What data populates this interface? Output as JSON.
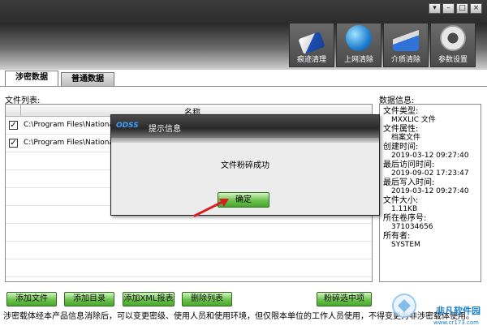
{
  "window": {
    "buttons": [
      "▾",
      "–",
      "□",
      "×"
    ]
  },
  "toolbar": [
    {
      "label": "痕迹清理",
      "icon": "eraser-icon"
    },
    {
      "label": "上网清除",
      "icon": "globe-icon"
    },
    {
      "label": "介质清除",
      "icon": "broom-icon"
    },
    {
      "label": "参数设置",
      "icon": "gear-icon"
    }
  ],
  "tabs": [
    {
      "label": "涉密数据",
      "active": true
    },
    {
      "label": "普通数据",
      "active": false
    }
  ],
  "labels": {
    "file_list": "文件列表:",
    "data_info": "数据信息:"
  },
  "table": {
    "header": "名称",
    "rows": [
      {
        "checked": true,
        "path": "C:\\Program Files\\National I"
      },
      {
        "checked": true,
        "path": "C:\\Program Files\\National I"
      }
    ]
  },
  "info": [
    {
      "key": "文件类型:",
      "value": "MXXLIC 文件"
    },
    {
      "key": "文件属性:",
      "value": "档案文件"
    },
    {
      "key": "创建时间:",
      "value": "2019-03-12 09:27:40"
    },
    {
      "key": "最后访问时间:",
      "value": "2019-09-02 17:23:47"
    },
    {
      "key": "最后写入时间:",
      "value": "2019-03-12 09:27:40"
    },
    {
      "key": "文件大小:",
      "value": "1.11KB"
    },
    {
      "key": "所在卷序号:",
      "value": "371034656"
    },
    {
      "key": "所有者:",
      "value": "SYSTEM"
    }
  ],
  "buttons": {
    "add_file": "添加文件",
    "add_dir": "添加目录",
    "add_xml": "添加XML报表",
    "delete_list": "删除列表",
    "shred_selected": "粉碎选中项"
  },
  "status": "涉密载体经本产品信息消除后，可以变更密级、使用人员和使用环境，但仅限本单位的工作人员使用，不得变更为非涉密载体使用。",
  "dialog": {
    "title": "提示信息",
    "logo": "ODSS",
    "message": "文件粉碎成功",
    "ok": "确定"
  },
  "watermark": {
    "text": "非凡软件园",
    "url": "www.cr173.com"
  },
  "colors": {
    "accent_green": "#6bc24c",
    "arrow_red": "#d62020",
    "dark_header": "#2b2b2b"
  }
}
